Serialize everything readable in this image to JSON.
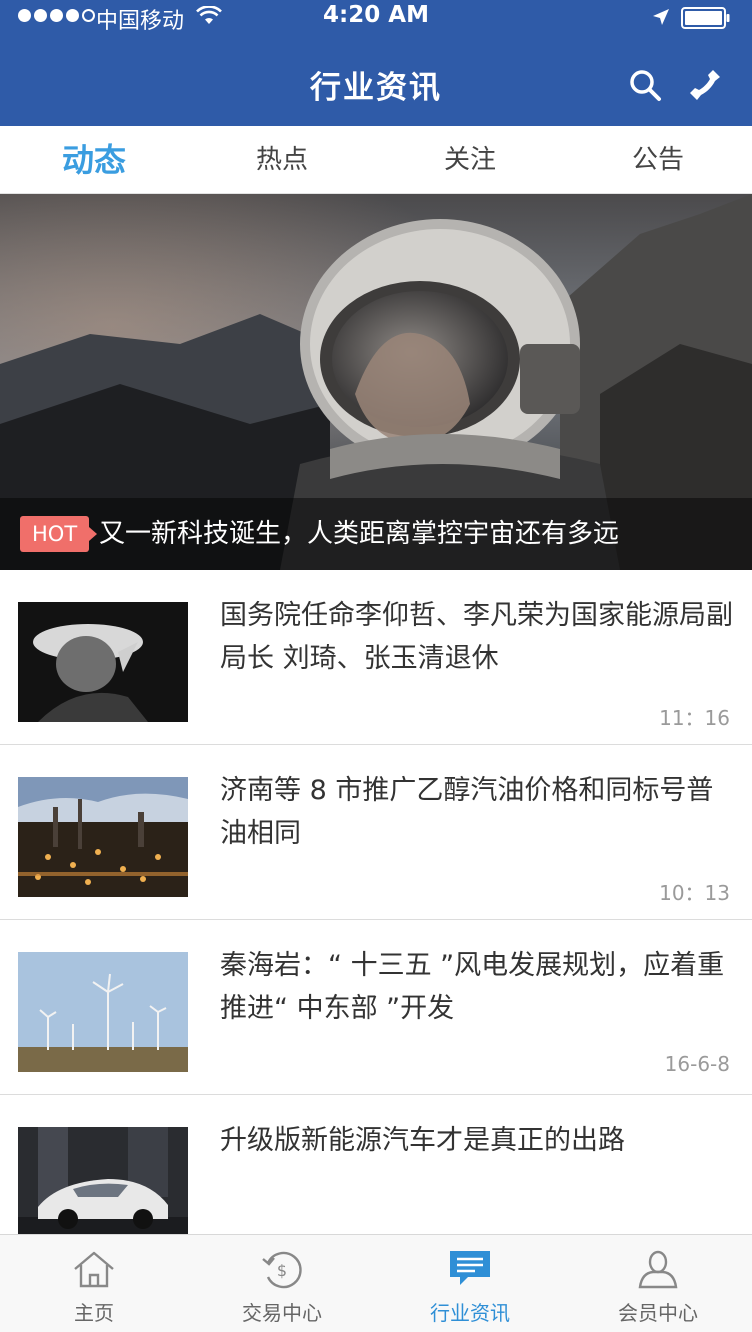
{
  "status_bar": {
    "carrier": "中国移动",
    "time": "4:20 AM"
  },
  "nav": {
    "title": "行业资讯",
    "icons": [
      "search-icon",
      "phone-icon"
    ]
  },
  "tabs": [
    {
      "label": "动态",
      "active": true
    },
    {
      "label": "热点",
      "active": false
    },
    {
      "label": "关注",
      "active": false
    },
    {
      "label": "公告",
      "active": false
    }
  ],
  "hero": {
    "badge": "HOT",
    "title": "又一新科技诞生，人类距离掌控宇宙还有多远"
  },
  "news": [
    {
      "title": "国务院任命李仰哲、李凡荣为国家能源局副局长 刘琦、张玉清退休",
      "time": "11：16"
    },
    {
      "title": "济南等 8 市推广乙醇汽油价格和同标号普油相同",
      "time": "10：13"
    },
    {
      "title": "秦海岩：“ 十三五 ”风电发展规划，应着重推进“ 中东部 ”开发",
      "time": "16-6-8"
    },
    {
      "title": "升级版新能源汽车才是真正的出路",
      "time": ""
    }
  ],
  "tabbar": [
    {
      "label": "主页",
      "icon": "home-icon",
      "active": false
    },
    {
      "label": "交易中心",
      "icon": "trade-icon",
      "active": false
    },
    {
      "label": "行业资讯",
      "icon": "news-icon",
      "active": true
    },
    {
      "label": "会员中心",
      "icon": "member-icon",
      "active": false
    }
  ],
  "colors": {
    "header": "#2f5ba8",
    "active_tab": "#3a9de0",
    "hot_badge": "#f06f6a",
    "tabbar_active": "#2f8fd6"
  }
}
